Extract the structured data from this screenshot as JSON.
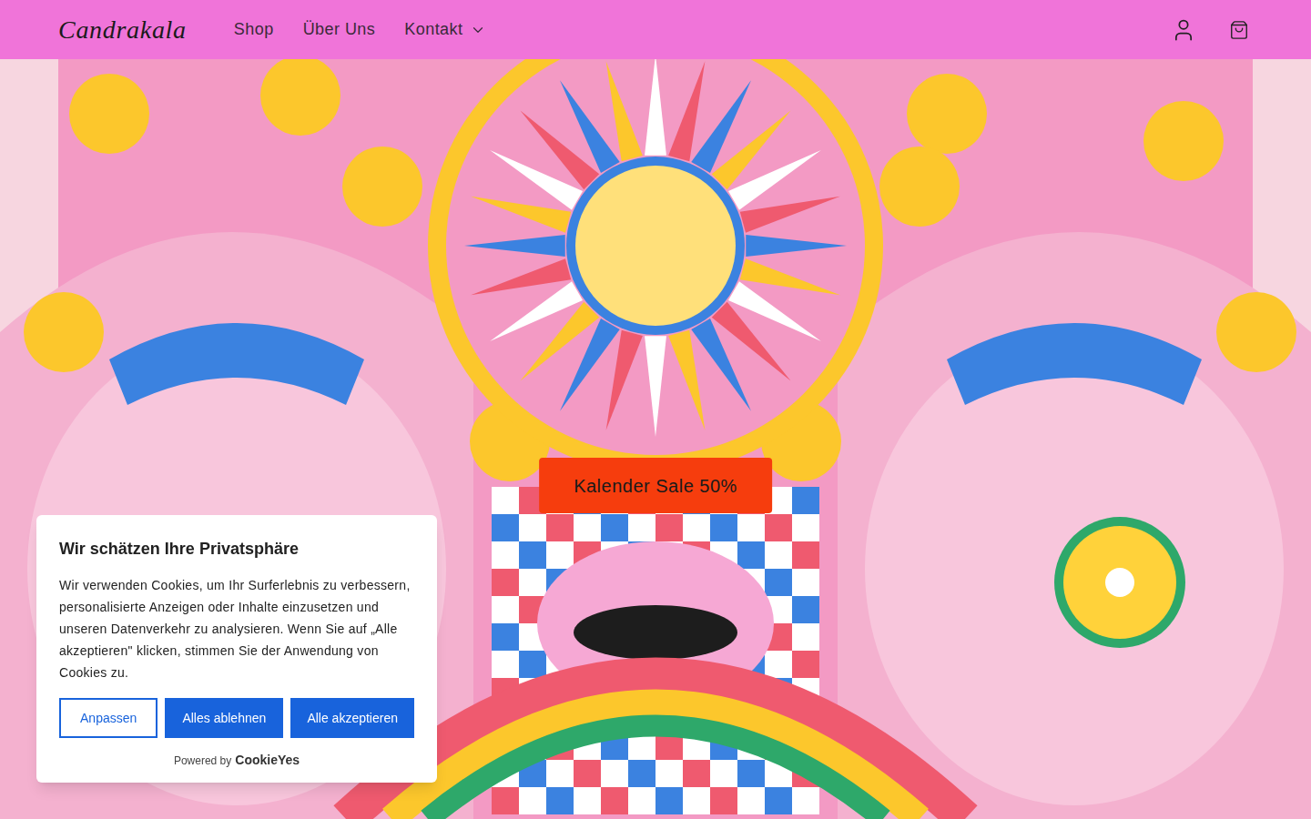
{
  "header": {
    "logo": "Candrakala",
    "nav": [
      {
        "label": "Shop",
        "dropdown": false
      },
      {
        "label": "Über Uns",
        "dropdown": false
      },
      {
        "label": "Kontakt",
        "dropdown": true
      }
    ]
  },
  "hero": {
    "button": "Kalender Sale 50%"
  },
  "cookie_banner": {
    "title": "Wir schätzen Ihre Privatsphäre",
    "text": "Wir verwenden Cookies, um Ihr Surferlebnis zu verbessern, personalisierte Anzeigen oder Inhalte einzusetzen und unseren Datenverkehr zu analysieren. Wenn Sie auf „Alle akzeptieren\" klicken, stimmen Sie der Anwendung von Cookies zu.",
    "buttons": [
      {
        "label": "Anpassen",
        "kind": "outline"
      },
      {
        "label": "Alles ablehnen",
        "kind": "filled"
      },
      {
        "label": "Alle akzeptieren",
        "kind": "filled"
      }
    ],
    "powered_by": "Powered by",
    "brand": "CookieYes"
  }
}
